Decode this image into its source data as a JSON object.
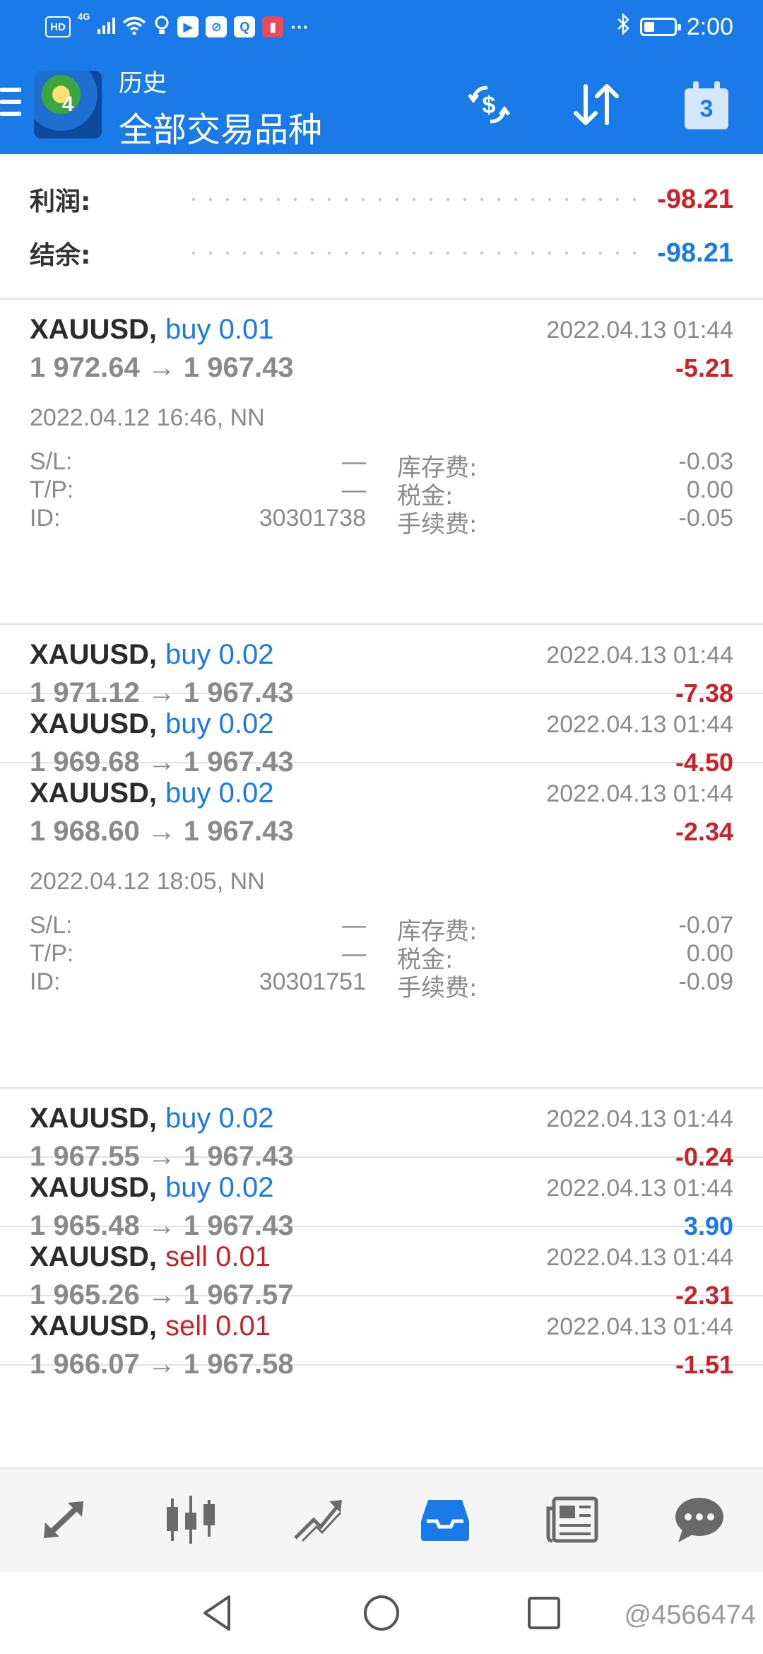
{
  "status_bar": {
    "left_badges": [
      "HD",
      "4G"
    ],
    "time": "2:00",
    "battery_level": 0.35,
    "more_glyph": "···"
  },
  "app_bar": {
    "title": "历史",
    "subtitle": "全部交易品种",
    "calendar_day": "3"
  },
  "summary": {
    "profit_label": "利润:",
    "profit_value": "-98.21",
    "balance_label": "结余:",
    "balance_value": "-98.21",
    "profit_color": "#c8232b",
    "balance_color": "#1a7be8"
  },
  "labels": {
    "sl": "S/L:",
    "tp": "T/P:",
    "id": "ID:",
    "swap": "库存费:",
    "tax": "税金:",
    "commission": "手续费:"
  },
  "trades": [
    {
      "symbol": "XAUUSD,",
      "side": "buy",
      "side_text": "buy 0.01",
      "time": "2022.04.13 01:44",
      "prices": "1 972.64 → 1 967.43",
      "profit": "-5.21",
      "expanded": true,
      "open_info": "2022.04.12 16:46, NN",
      "sl": "—",
      "tp": "—",
      "id": "30301738",
      "swap": "-0.03",
      "tax": "0.00",
      "commission": "-0.05"
    },
    {
      "symbol": "XAUUSD,",
      "side": "buy",
      "side_text": "buy 0.02",
      "time": "2022.04.13 01:44",
      "prices": "1 971.12 → 1 967.43",
      "profit": "-7.38",
      "expanded": false
    },
    {
      "symbol": "XAUUSD,",
      "side": "buy",
      "side_text": "buy 0.02",
      "time": "2022.04.13 01:44",
      "prices": "1 969.68 → 1 967.43",
      "profit": "-4.50",
      "expanded": false
    },
    {
      "symbol": "XAUUSD,",
      "side": "buy",
      "side_text": "buy 0.02",
      "time": "2022.04.13 01:44",
      "prices": "1 968.60 → 1 967.43",
      "profit": "-2.34",
      "expanded": true,
      "open_info": "2022.04.12 18:05, NN",
      "sl": "—",
      "tp": "—",
      "id": "30301751",
      "swap": "-0.07",
      "tax": "0.00",
      "commission": "-0.09"
    },
    {
      "symbol": "XAUUSD,",
      "side": "buy",
      "side_text": "buy 0.02",
      "time": "2022.04.13 01:44",
      "prices": "1 967.55 → 1 967.43",
      "profit": "-0.24",
      "expanded": false
    },
    {
      "symbol": "XAUUSD,",
      "side": "buy",
      "side_text": "buy 0.02",
      "time": "2022.04.13 01:44",
      "prices": "1 965.48 → 1 967.43",
      "profit": "3.90",
      "expanded": false
    },
    {
      "symbol": "XAUUSD,",
      "side": "sell",
      "side_text": "sell 0.01",
      "time": "2022.04.13 01:44",
      "prices": "1 965.26 → 1 967.57",
      "profit": "-2.31",
      "expanded": false
    },
    {
      "symbol": "XAUUSD,",
      "side": "sell",
      "side_text": "sell 0.01",
      "time": "2022.04.13 01:44",
      "prices": "1 966.07 → 1 967.58",
      "profit": "-1.51",
      "expanded": false
    }
  ],
  "bottom_nav": [
    {
      "icon": "quotes-icon",
      "active": false
    },
    {
      "icon": "chart-icon",
      "active": false
    },
    {
      "icon": "trade-icon",
      "active": false
    },
    {
      "icon": "history-icon",
      "active": true
    },
    {
      "icon": "news-icon",
      "active": false
    },
    {
      "icon": "chat-icon",
      "active": false
    }
  ],
  "colors": {
    "accent": "#1a7be8",
    "negative": "#c8232b",
    "positive": "#1a7be8",
    "muted": "#8a8a8a"
  },
  "watermark": "@4566474"
}
